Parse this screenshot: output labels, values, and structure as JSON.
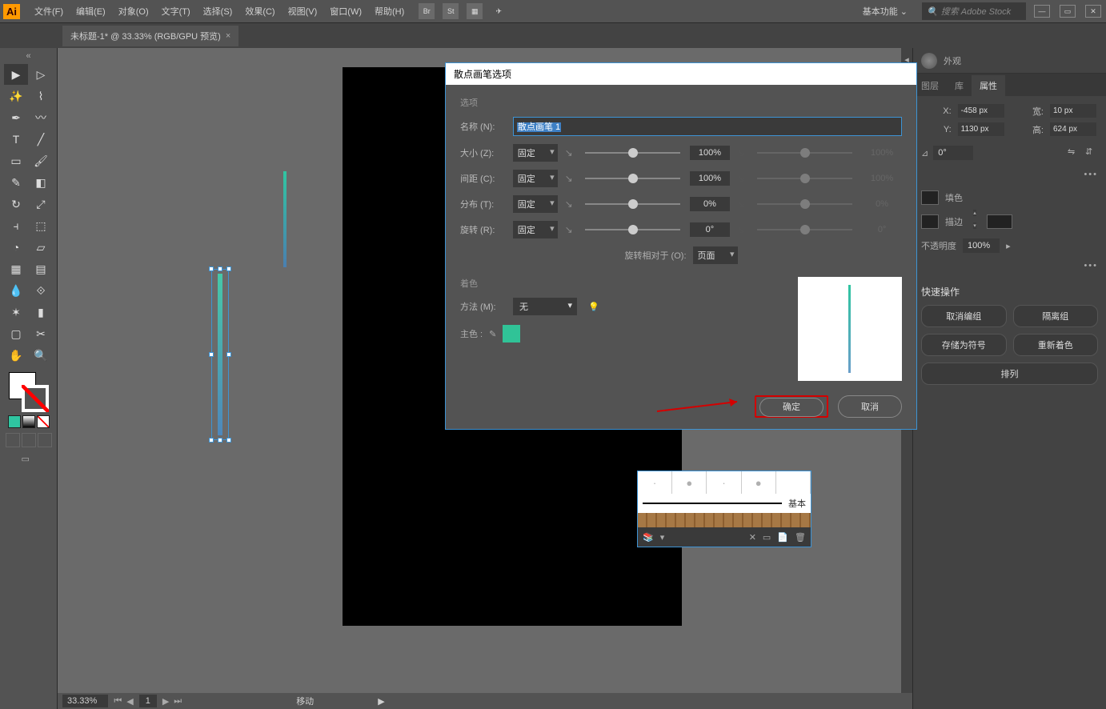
{
  "app": {
    "logo": "Ai"
  },
  "menu": {
    "file": "文件(F)",
    "edit": "编辑(E)",
    "object": "对象(O)",
    "type": "文字(T)",
    "select": "选择(S)",
    "effect": "效果(C)",
    "view": "视图(V)",
    "window": "窗口(W)",
    "help": "帮助(H)"
  },
  "topIcons": {
    "br": "Br",
    "st": "St"
  },
  "workspace": {
    "label": "基本功能"
  },
  "searchPlaceholder": "搜索 Adobe Stock",
  "docTab": {
    "title": "未标题-1* @ 33.33% (RGB/GPU 预览)",
    "close": "×"
  },
  "status": {
    "zoom": "33.33%",
    "layer": "1",
    "tool": "移动"
  },
  "rightPanel": {
    "appearance": "外观",
    "tabs": {
      "layers": "图层",
      "libraries": "库",
      "properties": "属性"
    },
    "transform": {
      "x_label": "X:",
      "x": "-458 px",
      "w_label": "宽:",
      "w": "10 px",
      "y_label": "Y:",
      "y": "1130 px",
      "h_label": "高:",
      "h": "624 px",
      "angle": "0°"
    },
    "fill_label": "填色",
    "stroke_label": "描边",
    "opacity_label": "不透明度",
    "opacity_val": "100%",
    "quick_title": "快速操作",
    "ungroup": "取消编组",
    "isolate": "隔离组",
    "save_symbol": "存储为符号",
    "recolor": "重新着色",
    "arrange": "排列"
  },
  "brushPanel": {
    "basic": "基本"
  },
  "dialog": {
    "title": "散点画笔选项",
    "options_header": "选项",
    "name_label": "名称 (N):",
    "name_value": "散点画笔 1",
    "size_label": "大小 (Z):",
    "spacing_label": "间距 (C):",
    "scatter_label": "分布 (T):",
    "rotation_label": "旋转 (R):",
    "fixed": "固定",
    "size_val": "100%",
    "spacing_val": "100%",
    "scatter_val": "0%",
    "rotation_val": "0°",
    "size_val2": "100%",
    "spacing_val2": "100%",
    "scatter_val2": "0%",
    "rotation_val2": "0°",
    "rotation_rel_label": "旋转相对于 (O):",
    "rotation_rel_val": "页面",
    "coloring_header": "着色",
    "method_label": "方法 (M):",
    "method_val": "无",
    "keycolor_label": "主色 :",
    "ok": "确定",
    "cancel": "取消"
  }
}
